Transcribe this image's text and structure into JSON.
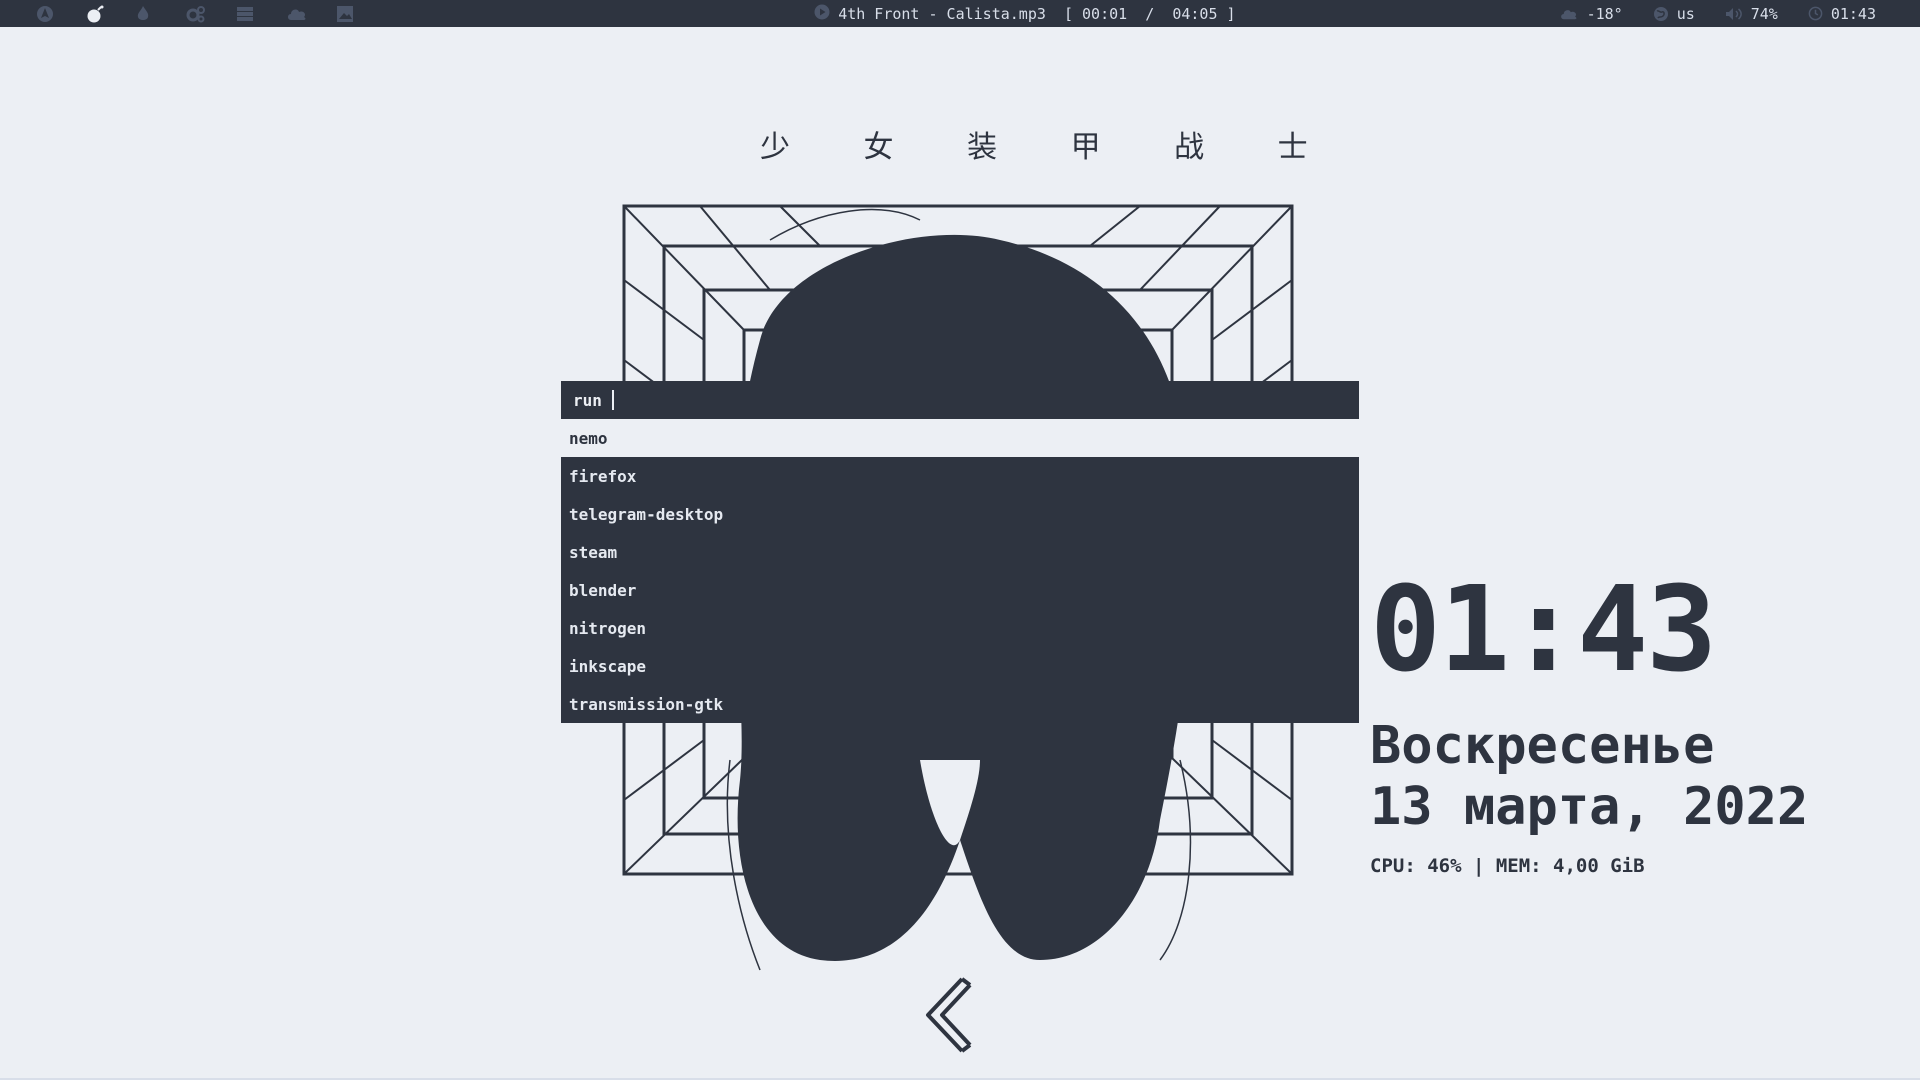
{
  "colors": {
    "background": "#eceff4",
    "bar": "#2e3440",
    "bar_text": "#d8dee9",
    "foreground": "#2e3440"
  },
  "topbar": {
    "workspace_icons": [
      "arch-icon",
      "bomb-icon",
      "flame-icon",
      "cogs-icon",
      "server-icon",
      "cloud-icon",
      "image-icon"
    ],
    "player": {
      "icon": "play-icon",
      "track": "4th Front - Calista.mp3",
      "progress": "[ 00:01  /  04:05 ]"
    },
    "status": {
      "weather": "-18°",
      "layout": "us",
      "volume": "74%",
      "clock": "01:43"
    }
  },
  "wallpaper": {
    "title": "少 女 装 甲 战 士"
  },
  "launcher": {
    "prompt": "run",
    "items": [
      {
        "label": "nemo",
        "selected": true
      },
      {
        "label": "firefox",
        "selected": false
      },
      {
        "label": "telegram-desktop",
        "selected": false
      },
      {
        "label": "steam",
        "selected": false
      },
      {
        "label": "blender",
        "selected": false
      },
      {
        "label": "nitrogen",
        "selected": false
      },
      {
        "label": "inkscape",
        "selected": false
      },
      {
        "label": "transmission-gtk",
        "selected": false
      }
    ]
  },
  "clock_widget": {
    "time": "01:43",
    "weekday": "Воскресенье",
    "date": "13 марта, 2022",
    "sysinfo": "CPU: 46% | MEM: 4,00 GiB"
  }
}
